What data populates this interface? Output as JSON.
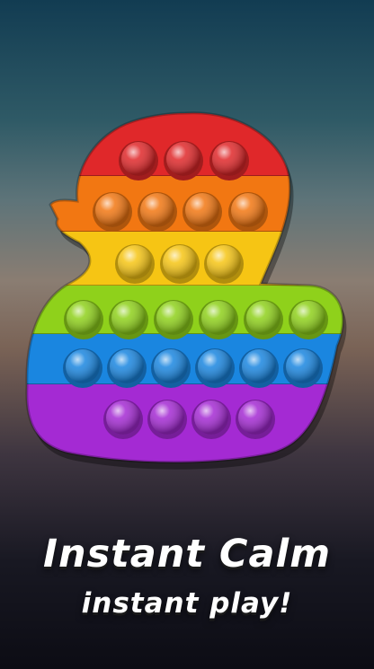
{
  "game": {
    "toy_name": "duck",
    "rows": [
      {
        "name": "red",
        "color": "#e0282a",
        "bubbles": 3
      },
      {
        "name": "orange",
        "color": "#f27712",
        "bubbles": 4
      },
      {
        "name": "yellow",
        "color": "#f6c514",
        "bubbles": 3
      },
      {
        "name": "green",
        "color": "#8fd11b",
        "bubbles": 6
      },
      {
        "name": "blue",
        "color": "#1a86e0",
        "bubbles": 6
      },
      {
        "name": "purple",
        "color": "#a42ad3",
        "bubbles": 4
      }
    ]
  },
  "tagline": {
    "line1": "Instant Calm",
    "line2": "instant play!"
  }
}
